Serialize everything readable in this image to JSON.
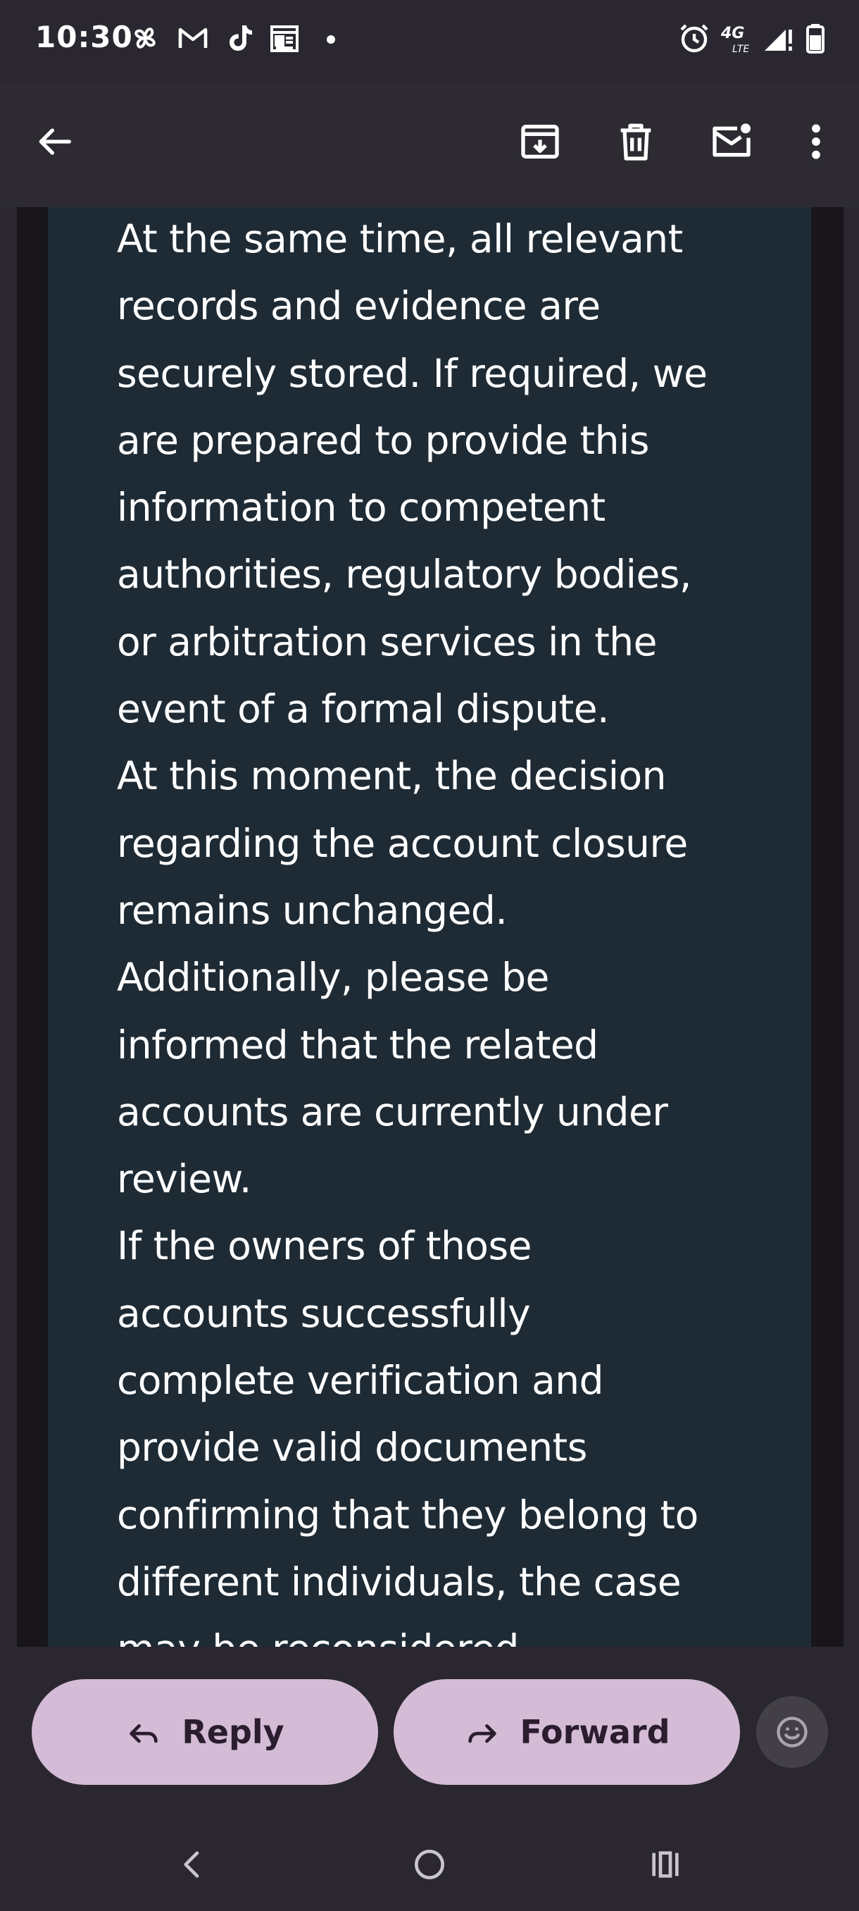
{
  "status_bar": {
    "time": "10:30",
    "left_icons": [
      "pinwheel-icon",
      "gmail-icon",
      "tiktok-icon",
      "news-icon"
    ],
    "right_icons": [
      "alarm-icon",
      "network-4g-lte-icon",
      "signal-icon",
      "battery-icon"
    ],
    "network_label": "4G LTE"
  },
  "app_bar": {
    "icons": [
      "back-arrow-icon",
      "archive-icon",
      "delete-icon",
      "mark-unread-icon",
      "more-vert-icon"
    ]
  },
  "message": {
    "lines": [
      "At the same time, all relevant",
      "records and evidence are",
      "securely stored. If required, we",
      "are prepared to provide this",
      "information to competent",
      "authorities, regulatory bodies,",
      "or arbitration services in the",
      "event of a formal dispute.",
      "At this moment, the decision",
      "regarding the account closure",
      "remains unchanged.",
      "Additionally, please be",
      "informed that the related",
      "accounts are currently under",
      "review.",
      "If the owners of those",
      "accounts successfully",
      "complete verification and",
      "provide valid documents",
      "confirming that they belong to",
      "different individuals, the case",
      "may be reconsidered."
    ]
  },
  "actions": {
    "reply_label": "Reply",
    "forward_label": "Forward",
    "emoji_icon": "emoji-smile-icon"
  },
  "nav_bar": {
    "icons": [
      "nav-back-icon",
      "nav-home-icon",
      "nav-recents-icon"
    ]
  },
  "colors": {
    "background": "#2a2730",
    "app_bar": "#2d2b31",
    "message_panel": "#1e2b35",
    "button_fill": "#d4bcd6",
    "button_text": "#2b1d2e",
    "text": "#ffffff"
  }
}
